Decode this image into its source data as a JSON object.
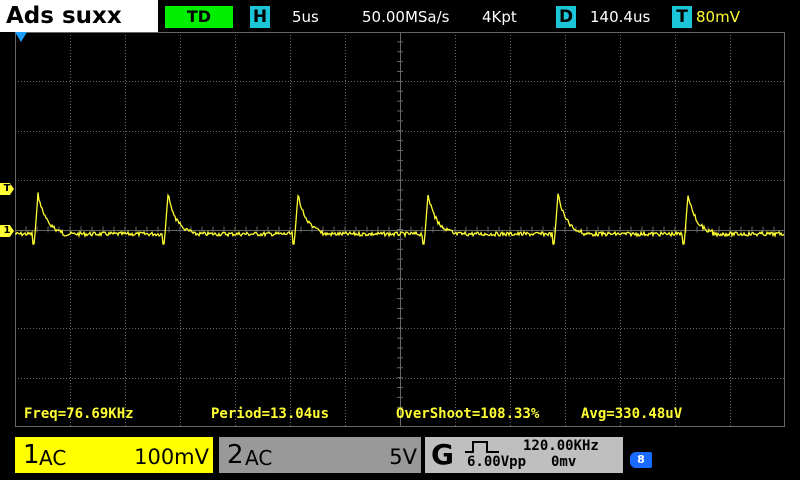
{
  "header": {
    "brand": "Ads suxx",
    "trigger_mode": "TD",
    "h_badge": "H",
    "timebase": "5us",
    "sample_rate": "50.00MSa/s",
    "memory_depth": "4Kpt",
    "d_badge": "D",
    "delay": "140.4us",
    "t_badge": "T",
    "trigger_level": "80mV"
  },
  "markers": {
    "trigger_marker": "T",
    "channel1_marker": "1"
  },
  "measurements": {
    "freq": "Freq=76.69KHz",
    "period": "Period=13.04us",
    "overshoot": "OverShoot=108.33%",
    "avg": "Avg=330.48uV"
  },
  "channel1": {
    "number": "1",
    "coupling": "AC",
    "scale": "100mV"
  },
  "channel2": {
    "number": "2",
    "coupling": "AC",
    "scale": "5V"
  },
  "generator": {
    "label": "G",
    "frequency": "120.00KHz",
    "amplitude": "6.00Vpp",
    "offset": "0mv"
  },
  "colors": {
    "channel1": "#ffff33",
    "grid": "#666666",
    "trigger_mode_bg": "#00ee00",
    "badge_bg": "#1cc6d8",
    "channel2_bg": "#999999",
    "generator_bg": "#bfbfbf"
  },
  "usb_icon": "usb-storage-icon"
}
